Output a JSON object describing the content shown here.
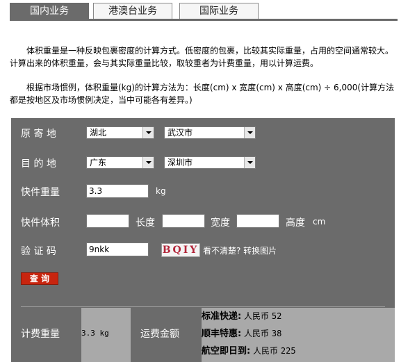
{
  "tabs": [
    {
      "label": "国内业务",
      "active": true
    },
    {
      "label": "港澳台业务",
      "active": false
    },
    {
      "label": "国际业务",
      "active": false
    }
  ],
  "intro": {
    "para1": "体积重量是一种反映包裹密度的计算方式。低密度的包裹，比较其实际重量，占用的空间通常较大。计算出来的体积重量，会与其实际重量比较，取较重者为计费重量，用以计算运费。",
    "para2": "根据市场惯例，体积重量(kg)的计算方法为：长度(cm) x 宽度(cm) x 高度(cm) ÷ 6,000(计算方法都是按地区及市场惯例决定，当中可能各有差异。)"
  },
  "form": {
    "origin_label": "原 寄 地",
    "origin_province": "湖北",
    "origin_city": "武汉市",
    "dest_label": "目 的 地",
    "dest_province": "广东",
    "dest_city": "深圳市",
    "weight_label": "快件重量",
    "weight_value": "3.3",
    "weight_unit": "kg",
    "volume_label": "快件体积",
    "length_value": "",
    "length_label": "长度",
    "width_value": "",
    "width_label": "宽度",
    "height_value": "",
    "height_label": "高度",
    "volume_unit": "cm",
    "captcha_label": "验 证 码",
    "captcha_value": "9nkk",
    "captcha_image_text": "BQIY",
    "captcha_refresh": "看不清楚? 转换图片",
    "query_button": "查 询"
  },
  "result": {
    "charge_weight_label": "计费重量",
    "charge_weight_value": "3.3 kg",
    "fee_label": "运费金额",
    "fees": [
      {
        "service": "标准快递:",
        "currency": "人民币",
        "amount": "52"
      },
      {
        "service": "顺丰特惠:",
        "currency": "人民币",
        "amount": "38"
      },
      {
        "service": "航空即日到:",
        "currency": "人民币",
        "amount": "225"
      }
    ]
  },
  "colors": {
    "panel_bg": "#6b6b6b",
    "result_bg": "#a9a9a9",
    "button_red": "#c8250f"
  }
}
